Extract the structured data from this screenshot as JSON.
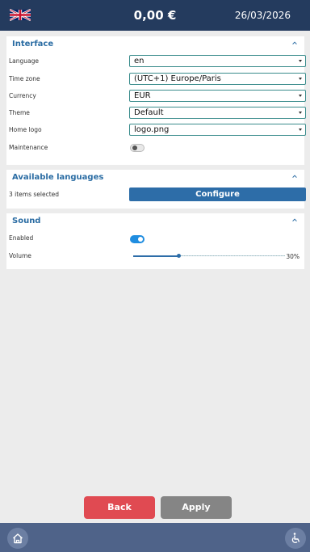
{
  "header": {
    "balance": "0,00 €",
    "date": "26/03/2026",
    "flag_icon": "uk-flag-icon"
  },
  "interface": {
    "title": "Interface",
    "fields": [
      {
        "label": "Language",
        "value": "en"
      },
      {
        "label": "Time zone",
        "value": "(UTC+1) Europe/Paris"
      },
      {
        "label": "Currency",
        "value": "EUR"
      },
      {
        "label": "Theme",
        "value": "Default"
      },
      {
        "label": "Home logo",
        "value": "logo.png"
      }
    ],
    "maintenance": {
      "label": "Maintenance",
      "enabled": false
    }
  },
  "languages": {
    "title": "Available languages",
    "summary": "3 items selected",
    "button": "Configure"
  },
  "sound": {
    "title": "Sound",
    "enabled_label": "Enabled",
    "enabled": true,
    "volume_label": "Volume",
    "volume_value": "30%",
    "volume_fraction": 0.3
  },
  "actions": {
    "back": "Back",
    "apply": "Apply"
  },
  "footer": {
    "home_icon": "home-icon",
    "accessibility_icon": "accessibility-icon"
  },
  "colors": {
    "header": "#243b5e",
    "accent": "#2a6ca3",
    "back": "#e04a52",
    "apply": "#858585",
    "footer": "#4f6389"
  }
}
